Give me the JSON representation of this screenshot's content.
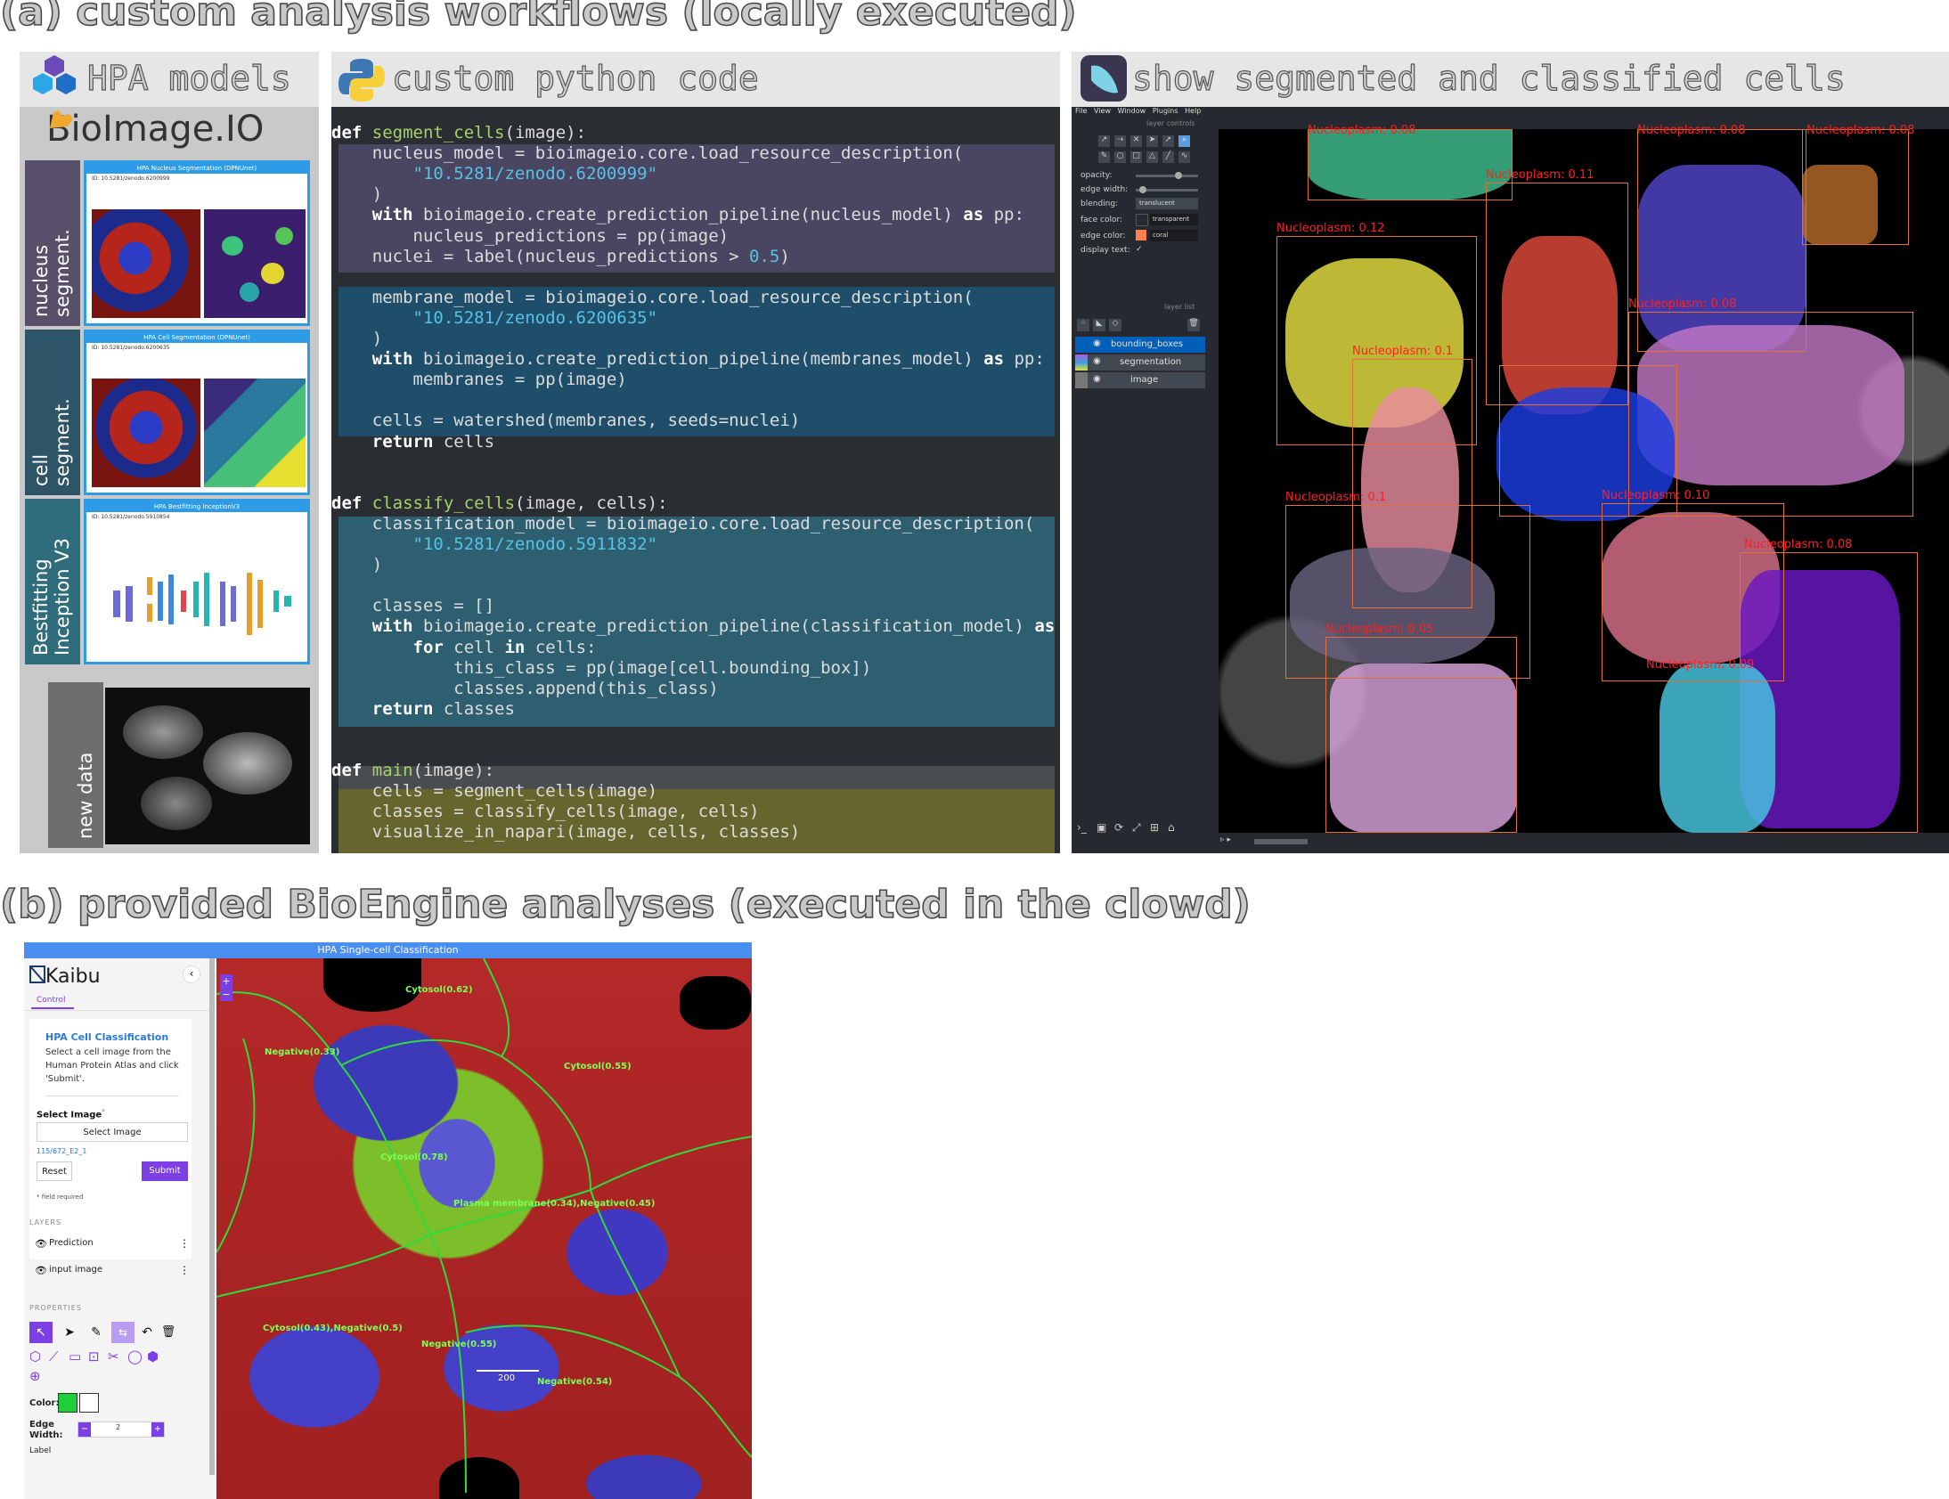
{
  "headings": {
    "a": "(a) custom analysis workflows (locally executed)",
    "b": "(b) provided BioEngine analyses (executed in the clowd)"
  },
  "hpa": {
    "title": "HPA models",
    "bioimage": "BioImage.IO",
    "tabs": [
      {
        "label": "nucleus\nsegment.",
        "color": "#58506b"
      },
      {
        "label": "cell\nsegment.",
        "color": "#2e5468"
      },
      {
        "label": "Bestfitting\nInception V3",
        "color": "#2f6d7c"
      },
      {
        "label": "new data",
        "color": "#6d6d6d"
      }
    ],
    "cards": [
      {
        "title": "HPA Nucleus Segmentation (DPNUnet)",
        "id": "ID: 10.5281/zenodo.6200999"
      },
      {
        "title": "HPA Cell Segmentation (DPNUnet)",
        "id": "ID: 10.5281/zenodo.6200635"
      },
      {
        "title": "HPA Bestfitting InceptionV3",
        "id": "ID: 10.5281/zenodo.5910854"
      }
    ]
  },
  "code_panel": {
    "title": "custom python code",
    "lines": [
      "<span class='kw'>def</span> <span class='fn'>segment_cells</span>(image):",
      "    nucleus_model = bioimageio.core.load_resource_description(",
      "        <span class='st'>\"10.5281/zenodo.6200999\"</span>",
      "    )",
      "    <span class='kw'>with</span> bioimageio.create_prediction_pipeline(nucleus_model) <span class='kw'>as</span> pp:",
      "        nucleus_predictions = pp(image)",
      "    nuclei = label(nucleus_predictions > <span class='nu'>0.5</span>)",
      "",
      "    membrane_model = bioimageio.core.load_resource_description(",
      "        <span class='st'>\"10.5281/zenodo.6200635\"</span>",
      "    )",
      "    <span class='kw'>with</span> bioimageio.create_prediction_pipeline(membranes_model) <span class='kw'>as</span> pp:",
      "        membranes = pp(image)",
      "",
      "    cells = watershed(membranes, seeds=nuclei)",
      "    <span class='kw'>return</span> cells",
      "",
      "",
      "<span class='kw'>def</span> <span class='fn'>classify_cells</span>(image, cells):",
      "    classification_model = bioimageio.core.load_resource_description(",
      "        <span class='st'>\"10.5281/zenodo.5911832\"</span>",
      "    )",
      "",
      "    classes = []",
      "    <span class='kw'>with</span> bioimageio.create_prediction_pipeline(classification_model) <span class='kw'>as</span> pp:",
      "        <span class='kw'>for</span> cell <span class='kw'>in</span> cells:",
      "            this_class = pp(image[cell.bounding_box])",
      "            classes.append(this_class)",
      "    <span class='kw'>return</span> classes",
      "",
      "",
      "<span class='kw'>def</span> <span class='fn'>main</span>(image):",
      "    cells = segment_cells(image)",
      "    classes = classify_cells(image, cells)",
      "    visualize_in_napari(image, cells, classes)"
    ]
  },
  "napari": {
    "title": "show segmented and classified cells",
    "menu": [
      "File",
      "View",
      "Window",
      "Plugins",
      "Help"
    ],
    "layer_controls_label": "layer controls",
    "layer_list_label": "layer list",
    "controls": [
      {
        "label": "opacity:",
        "value": ""
      },
      {
        "label": "edge width:",
        "value": ""
      },
      {
        "label": "blending:",
        "value": "translucent"
      },
      {
        "label": "face color:",
        "value": "transparent"
      },
      {
        "label": "edge color:",
        "value": "coral"
      },
      {
        "label": "display text:",
        "value": "✓"
      }
    ],
    "layers": [
      "bounding_boxes",
      "segmentation",
      "image"
    ],
    "labels": [
      "Nucleoplasm: 0.08",
      "Nucleoplasm: 0.08",
      "Nucleoplasm: 0.08",
      "Nucleoplasm: 0.11",
      "Nucleoplasm: 0.12",
      "Nucleoplasm: 0.08",
      "Nucleoplasm: 0.1",
      "Nucleoplasm: 0.10",
      "Nucleoplasm: 0.1",
      "Nucleoplasm: 0.08",
      "Nucleoplasm: 0.05",
      "Nucleoplasm: 0.09"
    ]
  },
  "kaibu": {
    "window_title": "HPA Single-cell Classification",
    "brand": "Kaibu",
    "tab": "Control",
    "card_title": "HPA Cell Classification",
    "card_desc": "Select a cell image from the Human Protein Atlas and click 'Submit'.",
    "select_label": "Select Image",
    "select_required": "*",
    "select_button": "Select Image",
    "selected_value": "115/672_E2_1",
    "reset": "Reset",
    "submit": "Submit",
    "field_required": "* field required",
    "layers_header": "LAYERS",
    "layers": [
      "Prediction",
      "input image"
    ],
    "properties_header": "PROPERTIES",
    "color_label": "Color:",
    "edge_width_label": "Edge Width:",
    "edge_width_value": "2",
    "label_label": "Label",
    "zoom_in": "+",
    "zoom_out": "−",
    "scale_bar": "200",
    "overlays": [
      "Cytosol(0.62)",
      "Negative(0.33)",
      "Cytosol(0.55)",
      "Cytosol(0.78)",
      "Plasma membrane(0.34),Negative(0.45)",
      "Cytosol(0.43),Negative(0.5)",
      "Negative(0.55)",
      "Negative(0.54)"
    ]
  },
  "colors": {
    "brand_purple": "#7b3fe4",
    "code_blue1": "#4a4560",
    "code_blue2": "#1f4e6a",
    "code_teal": "#2e5f70",
    "code_olive": "#65652d",
    "napari_bg": "#262930",
    "coral": "#ff7f50",
    "segment_green": "#7cff56"
  }
}
